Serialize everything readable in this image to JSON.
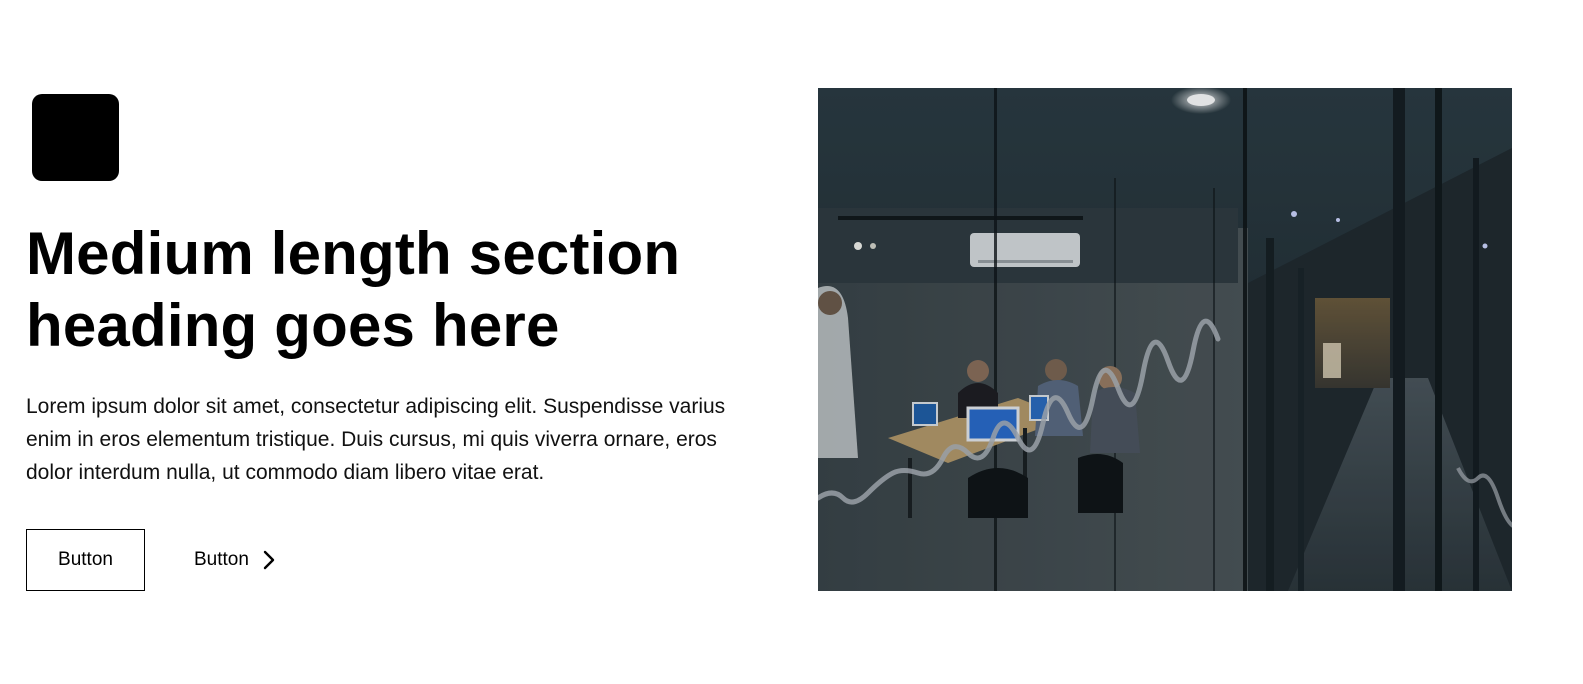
{
  "section": {
    "heading": "Medium length section heading goes here",
    "body": "Lorem ipsum dolor sit amet, consectetur adipiscing elit. Suspendisse varius enim in eros elementum tristique. Duis cursus, mi quis viverra ornare, eros dolor interdum nulla, ut commodo diam libero vitae erat.",
    "primary_button_label": "Button",
    "secondary_button_label": "Button",
    "secondary_button_icon": "chevron-right-icon",
    "logo_icon": "logo-placeholder-icon",
    "image_subject": "office-meeting-room-photo"
  },
  "colors": {
    "text": "#000000",
    "background": "#ffffff",
    "logo": "#000000",
    "photo_dark": "#1d2a31"
  }
}
